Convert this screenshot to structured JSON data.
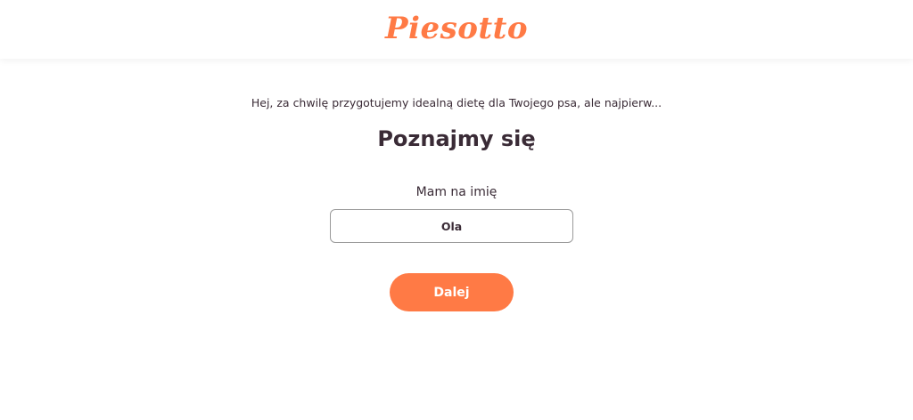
{
  "header": {
    "logo_text": "Piesotto"
  },
  "main": {
    "intro_text": "Hej, za chwilę przygotujemy idealną dietę dla Twojego psa, ale najpierw...",
    "title": "Poznajmy się",
    "name_label": "Mam na imię",
    "name_value": "Ola",
    "next_label": "Dalej"
  },
  "colors": {
    "accent": "#ff7a45",
    "text": "#3a2b36",
    "input_border": "#9a9a9a"
  }
}
